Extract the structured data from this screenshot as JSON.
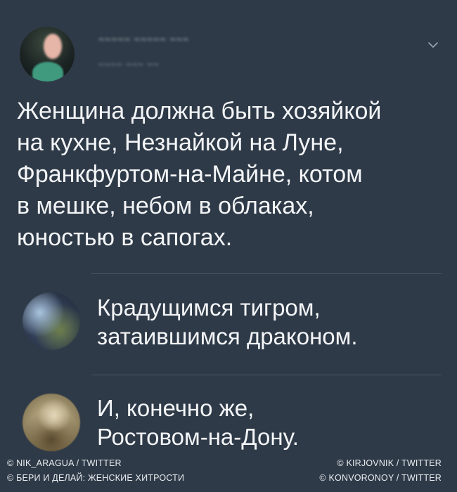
{
  "main_tweet": {
    "author_name_blurred": "~~~~~ ~~~~~ ~~~",
    "author_handle_blurred": "~~~~ ~~~ ~~",
    "menu_icon": "chevron-down-icon",
    "text_lines": [
      "Женщина должна быть хозяйкой",
      "на кухне, Незнайкой на Луне,",
      "Франкфуртом-на-Майне, котом",
      "в мешке, небом в облаках,",
      "юностью в сапогах."
    ]
  },
  "replies": [
    {
      "text_lines": [
        "Крадущимся тигром,",
        "затаившимся драконом."
      ]
    },
    {
      "text_lines": [
        "И, конечно же,",
        "Ростовом-на-Дону."
      ]
    }
  ],
  "credits": {
    "left": [
      "© NIK_ARAGUA / TWITTER",
      "© БЕРИ И ДЕЛАЙ: ЖЕНСКИЕ ХИТРОСТИ"
    ],
    "right": [
      "© KIRJOVNIK / TWITTER",
      "© KONVORONOY / TWITTER"
    ]
  },
  "colors": {
    "background": "#2f3a48",
    "text": "#f3f5f7",
    "divider": "#4a5563"
  }
}
